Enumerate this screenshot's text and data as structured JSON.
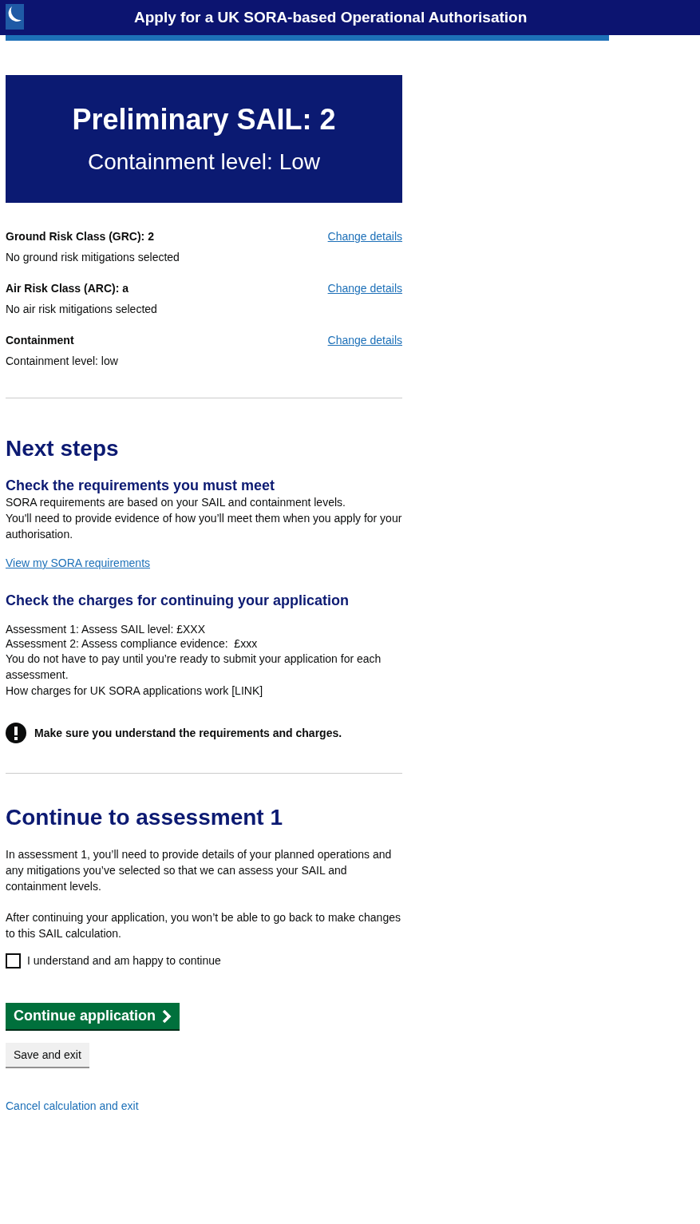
{
  "header": {
    "title": "Apply for a UK SORA-based Operational Authorisation"
  },
  "result": {
    "title": "Preliminary SAIL: 2",
    "subtitle": "Containment level: Low"
  },
  "summary": [
    {
      "label": "Ground Risk Class (GRC): 2",
      "value": "No ground risk mitigations selected",
      "action": "Change details"
    },
    {
      "label": "Air Risk Class (ARC): a",
      "value": "No air risk mitigations selected",
      "action": "Change details"
    },
    {
      "label": "Containment",
      "value": "Containment level: low",
      "action": "Change details"
    }
  ],
  "next_steps": {
    "heading": "Next steps",
    "requirements": {
      "heading": "Check the requirements you must meet",
      "paragraphs": [
        "SORA requirements are based on your SAIL and containment levels.",
        "You'll need to provide evidence of how you’ll meet them when you apply for your authorisation."
      ],
      "link": "View my SORA requirements"
    },
    "charges": {
      "heading": "Check the charges for continuing your application",
      "lines": [
        "Assessment 1: Assess SAIL level: £XXX",
        "Assessment 2: Assess compliance evidence:  £xxx"
      ],
      "paragraphs": [
        "You do not have to pay until you’re ready to submit your application for each assessment.",
        "How charges for UK SORA applications work [LINK]"
      ]
    },
    "warning": "Make sure you understand the requirements and charges."
  },
  "continue": {
    "heading": "Continue to assessment 1",
    "paragraphs": [
      "In assessment 1, you’ll need to provide details of your planned operations and any mitigations you’ve selected so that we can assess your SAIL and containment levels.",
      "After continuing your application, you won’t be able to go back to make changes to this SAIL calculation."
    ],
    "confirm": {
      "label": "I understand and am happy to continue",
      "checked": false
    },
    "primary_button": "Continue application",
    "secondary_button": "Save and exit",
    "cancel_link": "Cancel calculation and exit"
  }
}
